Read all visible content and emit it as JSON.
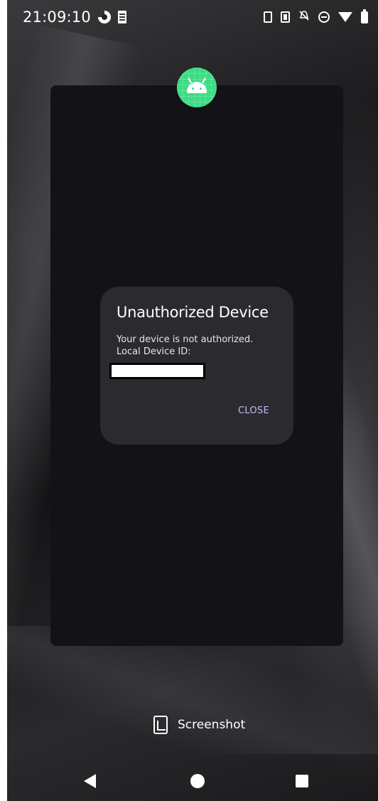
{
  "status_bar": {
    "time": "21:09:10",
    "left_icons": [
      "data-saver-icon",
      "sim-card-icon"
    ],
    "right_icons": [
      "phone-icon",
      "vibrate-icon",
      "alarm-off-icon",
      "do-not-disturb-icon",
      "wifi-icon",
      "battery-icon"
    ]
  },
  "app_icon": "android-icon",
  "dialog": {
    "title": "Unauthorized Device",
    "message_line1": "Your device is not authorized.",
    "message_line2": "Local Device ID:",
    "close_label": "CLOSE"
  },
  "screenshot_action": {
    "label": "Screenshot",
    "icon": "screenshot-icon"
  },
  "nav_bar": {
    "icons": [
      "back-icon",
      "home-icon",
      "recents-icon"
    ]
  },
  "colors": {
    "dialog_bg": "#2b2a2e",
    "card_bg": "#131216",
    "accent_button": "#c8b8f0",
    "android_green": "#3ddc84"
  }
}
